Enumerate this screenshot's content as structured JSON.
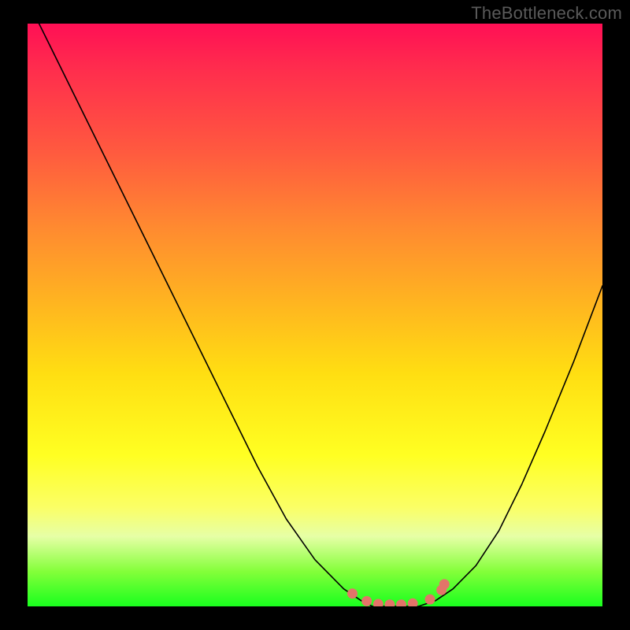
{
  "watermark": "TheBottleneck.com",
  "colors": {
    "background": "#000000",
    "curve_stroke": "#000000",
    "dot_fill": "#e37469",
    "watermark_text": "#5a5a5a"
  },
  "chart_data": {
    "type": "line",
    "title": "",
    "xlabel": "",
    "ylabel": "",
    "xlim": [
      0,
      100
    ],
    "ylim": [
      0,
      100
    ],
    "grid": false,
    "legend": false,
    "series": [
      {
        "name": "bottleneck-curve",
        "x": [
          0,
          5,
          10,
          15,
          20,
          25,
          30,
          35,
          40,
          45,
          50,
          55,
          58,
          60,
          62,
          65,
          68,
          71,
          74,
          78,
          82,
          86,
          90,
          95,
          100
        ],
        "y": [
          104,
          94,
          84,
          74,
          64,
          54,
          44,
          34,
          24,
          15,
          8,
          3,
          1,
          0,
          0,
          0,
          0,
          1,
          3,
          7,
          13,
          21,
          30,
          42,
          55
        ]
      }
    ],
    "dots": {
      "name": "highlighted-range",
      "x": [
        56.5,
        59,
        61,
        63,
        65,
        67,
        70,
        72,
        72.5
      ],
      "y": [
        2.2,
        0.9,
        0.4,
        0.3,
        0.3,
        0.5,
        1.2,
        2.8,
        3.8
      ]
    }
  }
}
